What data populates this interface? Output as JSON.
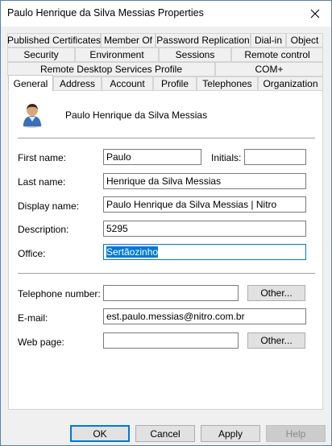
{
  "window": {
    "title": "Paulo Henrique da Silva Messias Properties"
  },
  "tabs": {
    "row1": [
      "Published Certificates",
      "Member Of",
      "Password Replication",
      "Dial-in",
      "Object"
    ],
    "row2": [
      "Security",
      "Environment",
      "Sessions",
      "Remote control"
    ],
    "row3": [
      "Remote Desktop Services Profile",
      "COM+"
    ],
    "row4": [
      "General",
      "Address",
      "Account",
      "Profile",
      "Telephones",
      "Organization"
    ],
    "active": "General"
  },
  "general": {
    "display_header": "Paulo Henrique da Silva Messias",
    "first_name": {
      "label": "First name:",
      "value": "Paulo"
    },
    "initials": {
      "label": "Initials:",
      "value": ""
    },
    "last_name": {
      "label": "Last name:",
      "value": "Henrique da Silva Messias"
    },
    "display_name": {
      "label": "Display name:",
      "value": "Paulo Henrique da Silva Messias | Nitro"
    },
    "description": {
      "label": "Description:",
      "value": "5295"
    },
    "office": {
      "label": "Office:",
      "value": "Sertãozinho"
    },
    "telephone": {
      "label": "Telephone number:",
      "value": "",
      "other_label": "Other..."
    },
    "email": {
      "label": "E-mail:",
      "value": "est.paulo.messias@nitro.com.br"
    },
    "web_page": {
      "label": "Web page:",
      "value": "",
      "other_label": "Other..."
    }
  },
  "buttons": {
    "ok": "OK",
    "cancel": "Cancel",
    "apply": "Apply",
    "help": "Help"
  },
  "icons": {
    "close": "close-icon",
    "user": "user-icon"
  }
}
